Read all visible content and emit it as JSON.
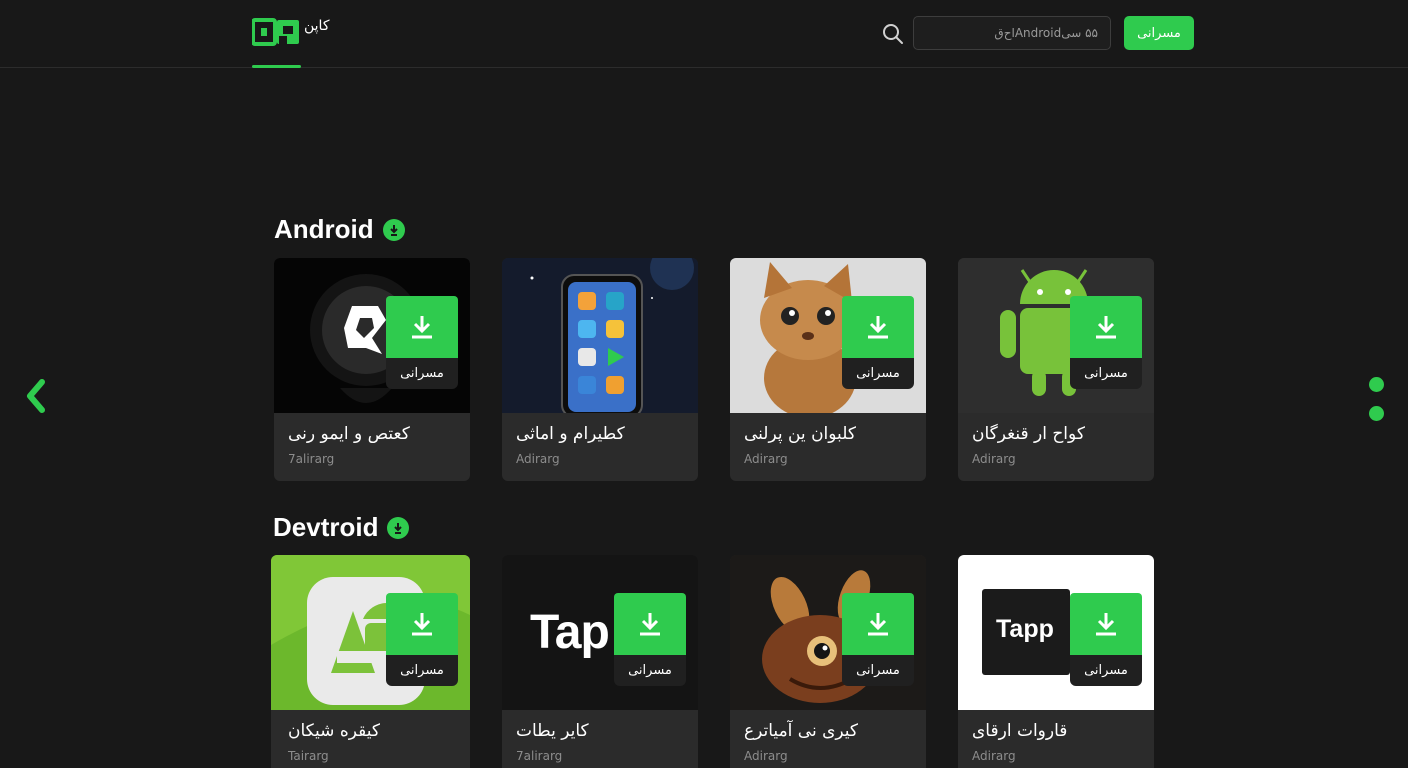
{
  "header": {
    "logo_text": "کاپن",
    "search_placeholder": "۵۵ سی‌Android‌ا‌‌‌ح‌ق",
    "action_button": "مسرانی"
  },
  "sections": [
    {
      "title": "Android",
      "cards": [
        {
          "title": "کعتص و ایمو رنی",
          "subtitle": "7alirarg",
          "button": "مسرانی",
          "icon": "black-logo-pin-icon"
        },
        {
          "title": "کطیرام و اماثی",
          "subtitle": "Adirarg",
          "button": "مسرانی",
          "icon": "smartphone-apps-icon"
        },
        {
          "title": "کلبوان ین پرلنی",
          "subtitle": "Adirarg",
          "button": "مسرانی",
          "icon": "kitten-icon"
        },
        {
          "title": "کواح ار قنغرگان",
          "subtitle": "Adirarg",
          "button": "مسرانی",
          "icon": "android-robot-icon"
        }
      ]
    },
    {
      "title": "Devtroid",
      "cards": [
        {
          "title": "کیقره شیکان",
          "subtitle": "Tairarg",
          "button": "مسرانی",
          "icon": "android-green-tile-icon"
        },
        {
          "title": "کایر یطات",
          "subtitle": "7alirarg",
          "button": "مسرانی",
          "icon": "tap-logo-icon",
          "logo_text": "Tap"
        },
        {
          "title": "کیری نی آمیاترع",
          "subtitle": "Adirarg",
          "button": "مسرانی",
          "icon": "creature-icon"
        },
        {
          "title": "قاروات ارقای",
          "subtitle": "Adirarg",
          "button": "مسرانی",
          "icon": "tapp-logo-icon",
          "logo_text": "Tapp"
        }
      ]
    }
  ],
  "colors": {
    "accent": "#2fcb4e",
    "background": "#181818",
    "card": "#2b2b2b"
  }
}
